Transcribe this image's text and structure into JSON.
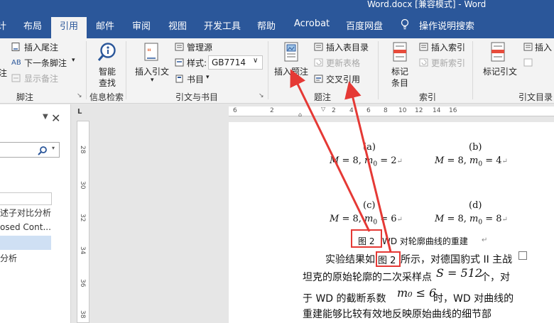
{
  "window": {
    "title": "Word.docx [兼容模式] - Word"
  },
  "tabs": [
    {
      "label": "计"
    },
    {
      "label": "布局"
    },
    {
      "label": "引用"
    },
    {
      "label": "邮件"
    },
    {
      "label": "审阅"
    },
    {
      "label": "视图"
    },
    {
      "label": "开发工具"
    },
    {
      "label": "帮助"
    },
    {
      "label": "Acrobat"
    },
    {
      "label": "百度网盘"
    },
    {
      "label": "操作说明搜索"
    }
  ],
  "ribbon": {
    "footnotes": {
      "insert_endnote": "插入尾注",
      "next_footnote": "下一条脚注",
      "show_notes": "显示备注",
      "partial_label": "注",
      "group": "脚注"
    },
    "research": {
      "smart_lookup_line1": "智能",
      "smart_lookup_line2": "查找",
      "group": "信息检索"
    },
    "citations": {
      "insert_citation": "插入引文",
      "manage_sources": "管理源",
      "style_label": "样式:",
      "style_value": "GB7714",
      "bibliography": "书目",
      "group": "引文与书目"
    },
    "captions": {
      "insert_caption": "插入题注",
      "insert_table_of_figures": "插入表目录",
      "update_table": "更新表格",
      "cross_reference": "交叉引用",
      "group": "题注"
    },
    "index": {
      "mark_entry_line1": "标记",
      "mark_entry_line2": "条目",
      "insert_index": "插入索引",
      "update_index": "更新索引",
      "group": "索引"
    },
    "table_of_authorities": {
      "mark_citation": "标记引文",
      "insert_partial": "插入",
      "group": "引文目录"
    }
  },
  "nav": {
    "items": [
      "述子对比分析",
      "osed Cont...",
      "分析"
    ]
  },
  "rulers": {
    "horizontal": [
      "6",
      "2",
      "2",
      "4",
      "6",
      "8",
      "10",
      "12",
      "14",
      "16"
    ],
    "horizontal_marker": "L",
    "vertical": [
      "28",
      "30",
      "32",
      "34",
      "36",
      "38"
    ]
  },
  "document": {
    "labels": [
      "(a)",
      "(b)",
      "(c)",
      "(d)"
    ],
    "eq_a": {
      "left": "M",
      "left_val": " = 8, ",
      "m": "m",
      "sub": "0",
      "right": " = 2"
    },
    "eq_b": {
      "left": "M",
      "left_val": " = 8, ",
      "m": "m",
      "sub": "0",
      "right": " = 4"
    },
    "eq_c": {
      "left": "M",
      "left_val": " = 8, ",
      "m": "m",
      "sub": "0",
      "right": " = 6"
    },
    "eq_d": {
      "left": "M",
      "left_val": " = 8, ",
      "m": "m",
      "sub": "0",
      "right": " = 8"
    },
    "caption_field": "图 2",
    "caption_text": "WD 对轮廓曲线的重建",
    "para1_start": "实验结果如",
    "para1_ref": "图 2",
    "para1_end": "所示，对德国豹式 II 主战",
    "para2_start": "坦克的原始轮廓的二次采样点",
    "para2_eq": "S = 512",
    "para2_end": "个，对",
    "para3_start": "于 WD 的截断系数",
    "para3_eq": "m₀ ≤ 6",
    "para3_end": "时，WD 对曲线的",
    "para4": "重建能够比较有效地反映原始曲线的细节部"
  },
  "colors": {
    "accent": "#2b579a",
    "annotation": "#e53935"
  }
}
